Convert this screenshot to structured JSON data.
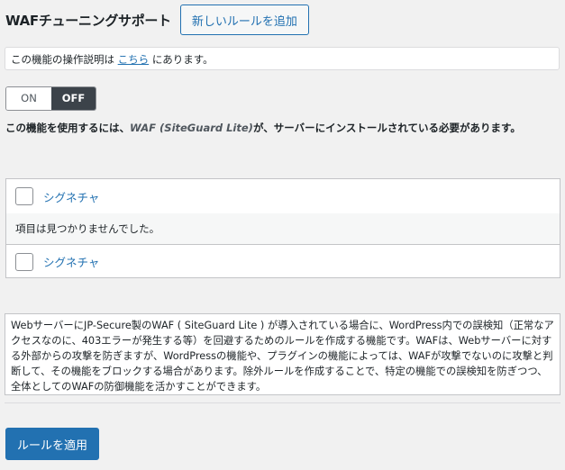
{
  "header": {
    "title": "WAFチューニングサポート",
    "add_button": "新しいルールを追加"
  },
  "notice": {
    "prefix": "この機能の操作説明は",
    "link": "こちら",
    "suffix": "にあります。"
  },
  "toggle": {
    "on_label": "ON",
    "off_label": "OFF",
    "selected": "OFF"
  },
  "requirement": {
    "prefix": "この機能を使用するには、",
    "product": "WAF (SiteGuard Lite)",
    "suffix": "が、サーバーにインストールされている必要があります。"
  },
  "table": {
    "header_label": "シグネチャ",
    "empty_message": "項目は見つかりませんでした。",
    "footer_label": "シグネチャ"
  },
  "description": "WebサーバーにJP-Secure製のWAF ( SiteGuard Lite ) が導入されている場合に、WordPress内での誤検知（正常なアクセスなのに、403エラーが発生する等）を回避するためのルールを作成する機能です。WAFは、Webサーバーに対する外部からの攻撃を防ぎますが、WordPressの機能や、プラグインの機能によっては、WAFが攻撃でないのに攻撃と判断して、その機能をブロックする場合があります。除外ルールを作成することで、特定の機能での誤検知を防ぎつつ、全体としてのWAFの防御機能を活かすことができます。",
  "apply_button": "ルールを適用",
  "colors": {
    "accent": "#2271b1",
    "toggle_active": "#3c434a",
    "background": "#f1f1f1"
  }
}
